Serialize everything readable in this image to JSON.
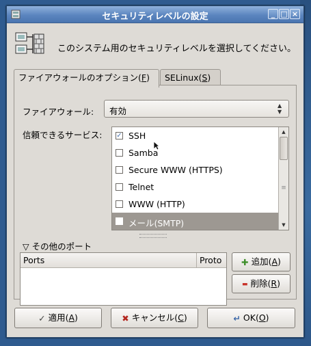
{
  "window": {
    "title": "セキュリティレベルの設定"
  },
  "header": {
    "text": "このシステム用のセキュリティレベルを選択してください。"
  },
  "tabs": [
    {
      "label_pre": "ファイアウォールのオプション(",
      "key": "F",
      "label_post": ")"
    },
    {
      "label_pre": "SELinux(",
      "key": "S",
      "label_post": ")"
    }
  ],
  "firewall": {
    "label": "ファイアウォール:",
    "value": "有効"
  },
  "services": {
    "label": "信頼できるサービス:",
    "items": [
      {
        "label": "SSH",
        "checked": true
      },
      {
        "label": "Samba",
        "checked": false
      },
      {
        "label": "Secure WWW (HTTPS)",
        "checked": false
      },
      {
        "label": "Telnet",
        "checked": false
      },
      {
        "label": "WWW (HTTP)",
        "checked": false
      },
      {
        "label": "メール(SMTP)",
        "checked": false,
        "selected": true
      }
    ]
  },
  "other_ports": {
    "toggle_label": "その他のポート",
    "columns": [
      "Ports",
      "Proto"
    ],
    "add_button": {
      "label_pre": "追加(",
      "key": "A",
      "label_post": ")"
    },
    "remove_button": {
      "label_pre": "削除(",
      "key": "R",
      "label_post": ")"
    }
  },
  "buttons": {
    "apply": {
      "label_pre": "適用(",
      "key": "A",
      "label_post": ")"
    },
    "cancel": {
      "label_pre": "キャンセル(",
      "key": "C",
      "label_post": ")"
    },
    "ok": {
      "label_pre": "OK(",
      "key": "O",
      "label_post": ")"
    }
  },
  "icons": {
    "check": "✓",
    "cross": "✖",
    "plus": "✚",
    "minus": "▬",
    "triangle_down": "▽"
  },
  "colors": {
    "titlebar": "#5b85bf",
    "selection": "#9d9892",
    "desktop": "#2f5b8f"
  }
}
